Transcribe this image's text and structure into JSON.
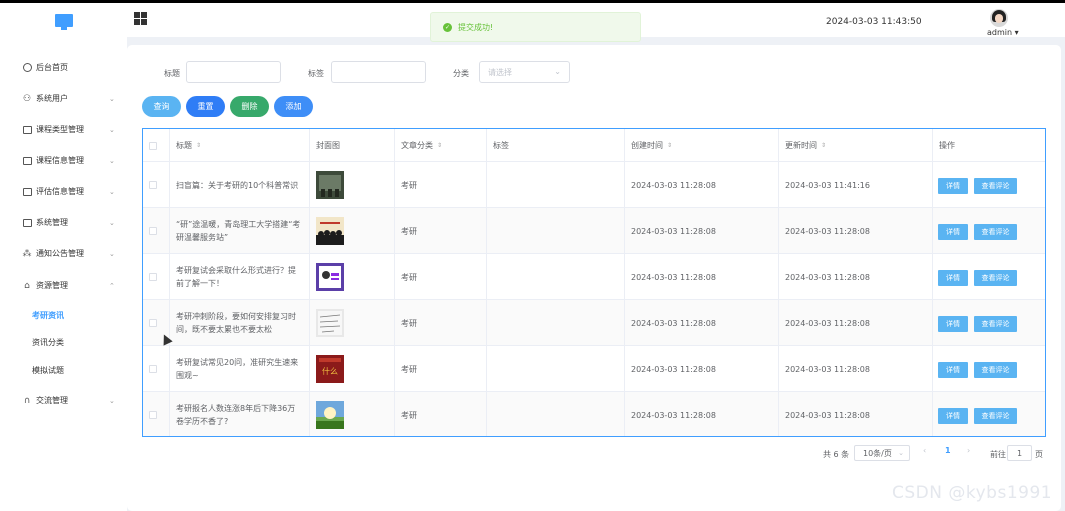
{
  "header": {
    "toast": "提交成功!",
    "datetime": "2024-03-03 11:43:50",
    "user": "admin"
  },
  "sidebar": {
    "items": [
      {
        "label": "后台首页",
        "icon": "clock-icon"
      },
      {
        "label": "系统用户",
        "icon": "user-icon"
      },
      {
        "label": "课程类型管理",
        "icon": "folder-icon"
      },
      {
        "label": "课程信息管理",
        "icon": "folder-icon"
      },
      {
        "label": "评估信息管理",
        "icon": "folder-icon"
      },
      {
        "label": "系统管理",
        "icon": "folder-icon"
      },
      {
        "label": "通知公告管理",
        "icon": "sparkle-icon"
      },
      {
        "label": "资源管理",
        "icon": "box-icon"
      }
    ],
    "sub_items": [
      {
        "label": "考研资讯",
        "active": true
      },
      {
        "label": "资讯分类",
        "active": false
      },
      {
        "label": "模拟试题",
        "active": false
      }
    ],
    "last_item": {
      "label": "交流管理",
      "icon": "headset-icon"
    }
  },
  "filters": {
    "title_label": "标题",
    "tag_label": "标签",
    "category_label": "分类",
    "category_placeholder": "请选择"
  },
  "buttons": {
    "query": "查询",
    "reset": "重置",
    "delete": "删除",
    "add": "添加"
  },
  "buttons_colors": {
    "query": "#5ab4f2",
    "reset": "#2f7df6",
    "delete": "#37a96b",
    "add": "#3e8ef7"
  },
  "table": {
    "columns": [
      "标题",
      "封面图",
      "文章分类",
      "标签",
      "创建时间",
      "更新时间",
      "操作"
    ],
    "rows": [
      {
        "title": "扫盲篇：关于考研的10个科普常识",
        "category": "考研",
        "created": "2024-03-03 11:28:08",
        "updated": "2024-03-03 11:41:16",
        "cover": "classroom"
      },
      {
        "title": "“研”途温暖，青岛理工大学搭建“考研温馨服务站”",
        "category": "考研",
        "created": "2024-03-03 11:28:08",
        "updated": "2024-03-03 11:28:08",
        "cover": "silhouettes"
      },
      {
        "title": "考研复试会采取什么形式进行？提前了解一下！",
        "category": "考研",
        "created": "2024-03-03 11:28:08",
        "updated": "2024-03-03 11:28:08",
        "cover": "purple-card"
      },
      {
        "title": "考研冲刺阶段，要如何安排复习时间，既不要太累也不要太松",
        "category": "考研",
        "created": "2024-03-03 11:28:08",
        "updated": "2024-03-03 11:28:08",
        "cover": "handwriting"
      },
      {
        "title": "考研复试常见20问，准研究生速来围观~",
        "category": "考研",
        "created": "2024-03-03 11:28:08",
        "updated": "2024-03-03 11:28:08",
        "cover": "red-poster"
      },
      {
        "title": "考研报名人数连涨8年后下降36万 卷学历不香了?",
        "category": "考研",
        "created": "2024-03-03 11:28:08",
        "updated": "2024-03-03 11:28:08",
        "cover": "sky"
      }
    ],
    "action_detail": "详情",
    "action_comments": "查看评论"
  },
  "pagination": {
    "total": "共 6 条",
    "page_size": "10条/页",
    "current": "1",
    "goto_label": "前往",
    "goto_value": "1",
    "page_suffix": "页",
    "prev": "‹",
    "next": "›"
  },
  "watermark": "CSDN @kybs1991"
}
